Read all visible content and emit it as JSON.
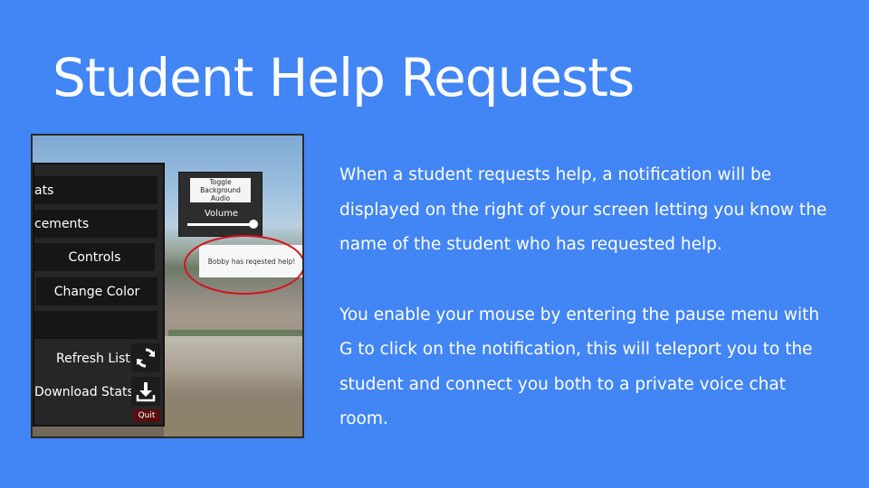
{
  "slide": {
    "title": "Student Help Requests",
    "paragraphs": [
      "When a student requests help, a notification will be displayed on the right of your screen letting you know the name of the student who has requested help.",
      "You enable your mouse by entering the pause menu with G to click on the notification, this will teleport you to the student and connect you both to a private voice chat room."
    ]
  },
  "screenshot": {
    "menu": {
      "stats_label": "ats",
      "achievements_label": "cements",
      "controls_label": "Controls",
      "change_color_label": "Change Color",
      "refresh_list_label": "Refresh List",
      "download_stats_label": "Download Stats",
      "quit_label": "Quit"
    },
    "audio": {
      "toggle_label": "Toggle Background Audio",
      "volume_label": "Volume",
      "volume_level": 1.0
    },
    "notification": {
      "text": "Bobby has reqested help!"
    }
  },
  "colors": {
    "background": "#4285f4",
    "highlight": "#d4131c",
    "quit": "#5a0d0d"
  }
}
